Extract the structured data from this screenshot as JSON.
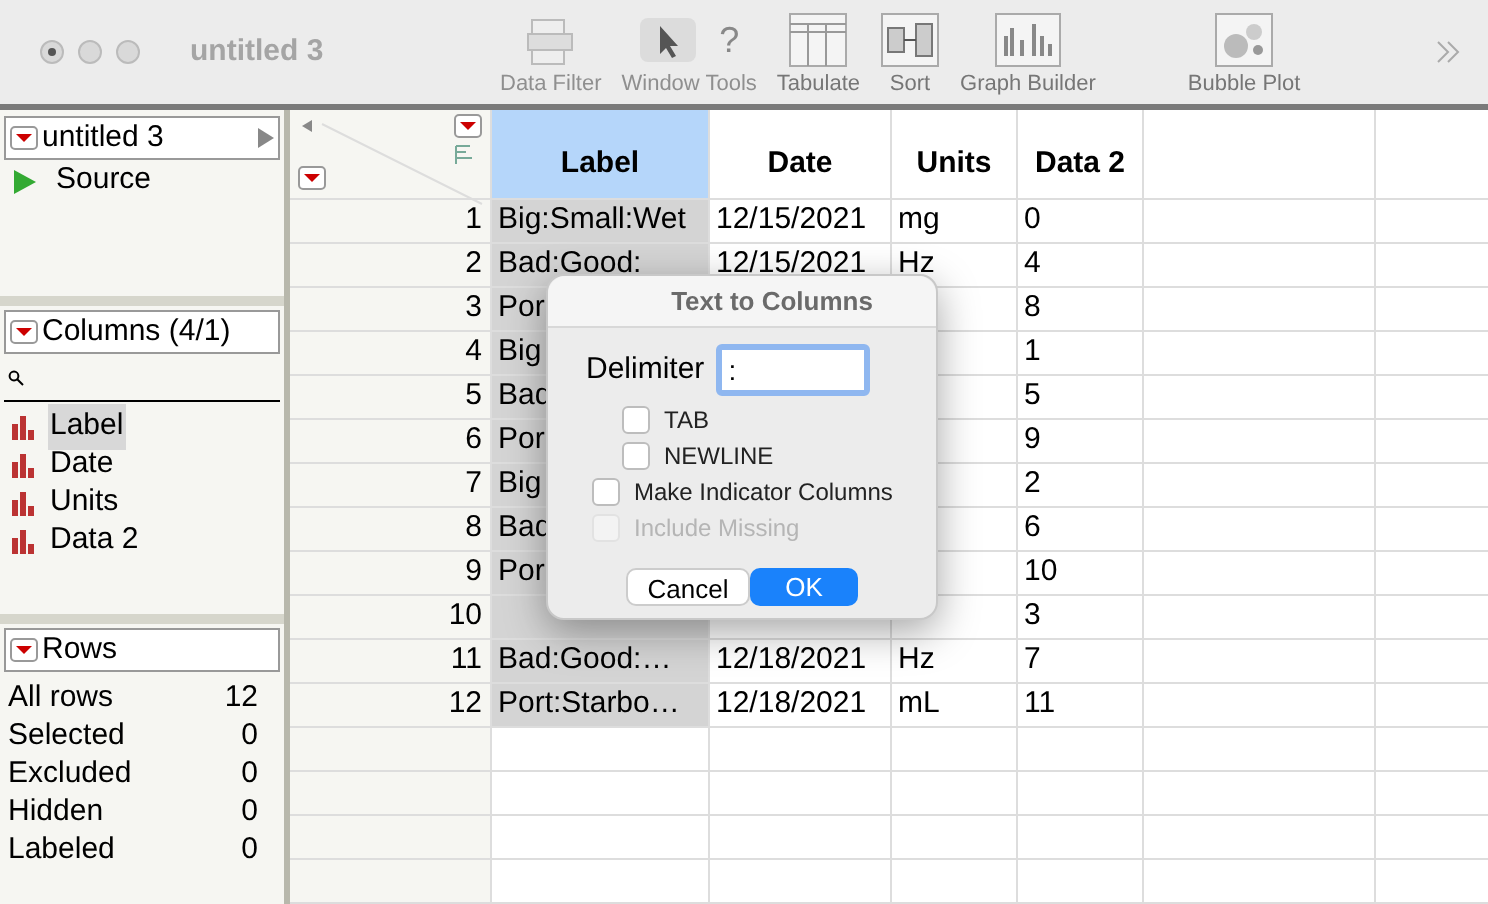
{
  "window": {
    "title": "untitled 3"
  },
  "toolbar": [
    {
      "label": "Data Filter",
      "kind": "filter",
      "disabled": true
    },
    {
      "label": "Window Tools",
      "kind": "tools",
      "disabled": true,
      "glyph": "?"
    },
    {
      "label": "Tabulate",
      "kind": "tabulate",
      "disabled": false
    },
    {
      "label": "Sort",
      "kind": "sort",
      "disabled": false
    },
    {
      "label": "Graph Builder",
      "kind": "graph",
      "disabled": false
    },
    {
      "label": "Bubble Plot",
      "kind": "bubble",
      "disabled": false
    }
  ],
  "table_panel": {
    "title": "untitled 3",
    "items": [
      "Source"
    ]
  },
  "columns_panel": {
    "title": "Columns (4/1)",
    "items": [
      {
        "name": "Label",
        "selected": true
      },
      {
        "name": "Date",
        "selected": false
      },
      {
        "name": "Units",
        "selected": false
      },
      {
        "name": "Data 2",
        "selected": false
      }
    ]
  },
  "rows_panel": {
    "title": "Rows",
    "items": [
      {
        "label": "All rows",
        "value": "12"
      },
      {
        "label": "Selected",
        "value": "0"
      },
      {
        "label": "Excluded",
        "value": "0"
      },
      {
        "label": "Hidden",
        "value": "0"
      },
      {
        "label": "Labeled",
        "value": "0"
      }
    ]
  },
  "table": {
    "columns": [
      {
        "name": "Label",
        "selected": true
      },
      {
        "name": "Date",
        "selected": false
      },
      {
        "name": "Units",
        "selected": false
      },
      {
        "name": "Data 2",
        "selected": false
      }
    ],
    "rows": [
      {
        "number": "1",
        "cells": [
          "Big:Small:Wet",
          "12/15/2021",
          "mg",
          "0"
        ]
      },
      {
        "number": "2",
        "cells": [
          "Bad:Good:",
          "12/15/2021",
          "Hz",
          "4"
        ]
      },
      {
        "number": "3",
        "cells": [
          "Por",
          null,
          null,
          "8"
        ]
      },
      {
        "number": "4",
        "cells": [
          "Big",
          null,
          null,
          "1"
        ]
      },
      {
        "number": "5",
        "cells": [
          "Bad",
          null,
          null,
          "5"
        ]
      },
      {
        "number": "6",
        "cells": [
          "Por",
          null,
          null,
          "9"
        ]
      },
      {
        "number": "7",
        "cells": [
          "Big",
          null,
          null,
          "2"
        ]
      },
      {
        "number": "8",
        "cells": [
          "Bad",
          null,
          null,
          "6"
        ]
      },
      {
        "number": "9",
        "cells": [
          "Por",
          null,
          null,
          "10"
        ]
      },
      {
        "number": "10",
        "cells": [
          null,
          null,
          null,
          "3"
        ]
      },
      {
        "number": "11",
        "cells": [
          "Bad:Good:…",
          "12/18/2021",
          "Hz",
          "7"
        ]
      },
      {
        "number": "12",
        "cells": [
          "Port:Starbo…",
          "12/18/2021",
          "mL",
          "11"
        ]
      }
    ]
  },
  "dialog": {
    "title": "Text to Columns",
    "delimiter_label": "Delimiter",
    "delimiter_value": ":",
    "options": [
      {
        "label": "TAB",
        "checked": false,
        "disabled": false,
        "indent": true
      },
      {
        "label": "NEWLINE",
        "checked": false,
        "disabled": false,
        "indent": true
      },
      {
        "label": "Make Indicator Columns",
        "checked": false,
        "disabled": false,
        "indent": false
      },
      {
        "label": "Include Missing",
        "checked": false,
        "disabled": true,
        "indent": false
      }
    ],
    "buttons": [
      {
        "label": "Cancel",
        "kind": "cancel"
      },
      {
        "label": "OK",
        "kind": "default"
      }
    ]
  }
}
